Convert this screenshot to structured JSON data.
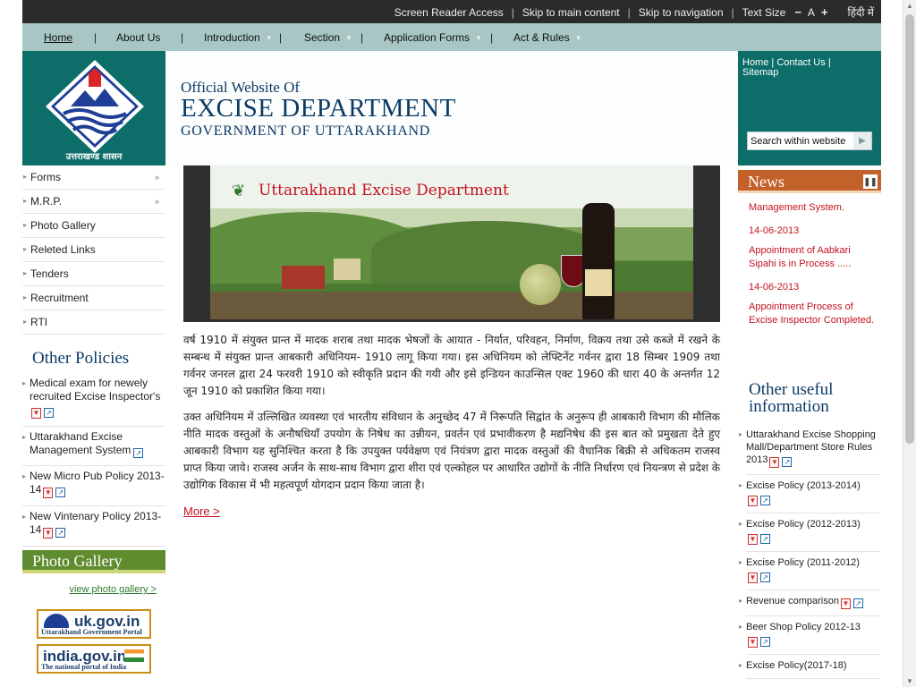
{
  "topbar": {
    "screen_reader": "Screen Reader Access",
    "skip_main": "Skip to main content",
    "skip_nav": "Skip to navigation",
    "text_size": "Text Size",
    "minus": "−",
    "a": "A",
    "plus": "+",
    "hindi": "हिंदी में"
  },
  "nav": {
    "home": "Home",
    "about": "About Us",
    "intro": "Introduction",
    "section": "Section",
    "forms": "Application Forms",
    "act": "Act & Rules"
  },
  "header": {
    "line1": "Official Website Of",
    "line2": "EXCISE DEPARTMENT",
    "line3": "GOVERNMENT OF UTTARAKHAND",
    "logo_text": "उत्तराखण्ड शासन",
    "top_home": "Home",
    "top_contact": "Contact Us",
    "top_sitemap": "Sitemap",
    "search_placeholder": "Search within website"
  },
  "left_nav": {
    "forms": "Forms",
    "mrp": "M.R.P.",
    "gallery": "Photo Gallery",
    "links": "Releted Links",
    "tenders": "Tenders",
    "recruit": "Recruitment",
    "rti": "RTI"
  },
  "policies": {
    "title": "Other Policies",
    "p1": "Medical exam for newely recruited Excise Inspector's",
    "p2": "Uttarakhand Excise Management System",
    "p3": "New Micro Pub Policy 2013-14",
    "p4": "New Vintenary Policy 2013-14"
  },
  "photo": {
    "title": "Photo Gallery",
    "link": "view photo gallery >"
  },
  "portals": {
    "uk_title": "uk.gov.in",
    "uk_sub": "Uttarakhand Government Portal",
    "india_title": "india.gov.in",
    "india_sub": "The national portal of India"
  },
  "slide": {
    "caption": "Uttarakhand Excise Department"
  },
  "content": {
    "para1": "वर्ष 1910 में संयुक्त प्रान्त में मादक शराब तथा मादक भेषजों के आयात - निर्यात, परिवहन, निर्माण, विक्रय तथा उसे कब्जे में रखने के सम्बन्ध में संयुक्त प्रान्त आबकारी अधिनियम- 1910 लागू किया गया। इस अधिनियम को लेफ्टिनेंट गर्वनर द्वारा 18 सिम्बर 1909 तथा गर्वनर जनरल द्वारा 24 फरवरी 1910 को स्वीकृति प्रदान की गयी और इसे इन्डियन काउन्सिल एक्ट 1960 की धारा 40 के अन्तर्गत 12 जून 1910 को प्रकाशित किया गया।",
    "para2": "उक्त अधिनियम में उल्लिखित व्यवस्था एवं भारतीय संविधान के अनुच्छेद 47 में निरूपति सिद्वांत के अनुरूप ही आबकारी विभाग की मौलिक नीति मादक वस्तुओं के अनौषधियॉं उपयोग के निषेध का उन्नीयन, प्रवर्तन एवं प्रभावीकरण है मद्यनिषेध की इस बात को प्रमुखता देते हुए आबकारी विभाग यह सुनिश्चित करता है कि उपयुक्त पर्यवेक्षण एवं नियंत्रण द्वारा मादक वस्तुओं की वैधानिक बिक्री से अधिकतम राजस्व प्राप्त किया जाये। राजस्व अर्जन के साथ-साथ विभाग द्वारा शीरा एवं एल्कोहल पर आधारित उद्योगों के नीति निर्धारण एवं नियन्त्रण से प्रदेश के उद्योगिक विकास में भी महत्वपूर्ण योगदान प्रदान किया जाता है।",
    "more": "More >"
  },
  "news": {
    "title": "News",
    "item0": "Management System.",
    "date1": "14-06-2013",
    "item1": "Appointment of Aabkari Sipahi is in Process .....",
    "date2": "14-06-2013",
    "item2": "Appointment Process of Excise Inspector Completed."
  },
  "useful": {
    "title1": "Other useful",
    "title2": "information",
    "u1": "Uttarakhand Excise Shopping Mall/Department Store Rules 2013",
    "u2": "Excise Policy (2013-2014)",
    "u3": "Excise Policy (2012-2013)",
    "u4": "Excise Policy (2011-2012)",
    "u5": "Revenue comparison",
    "u6": "Beer Shop Policy 2012-13",
    "u7": "Excise Policy(2017-18)"
  },
  "colors": {
    "teal": "#0d6e69",
    "nav_bg": "#a7c6c4",
    "news_orange": "#c2622a",
    "gallery_green": "#5e8c2f",
    "link_red": "#c4121f",
    "title_blue": "#0b3a66"
  }
}
